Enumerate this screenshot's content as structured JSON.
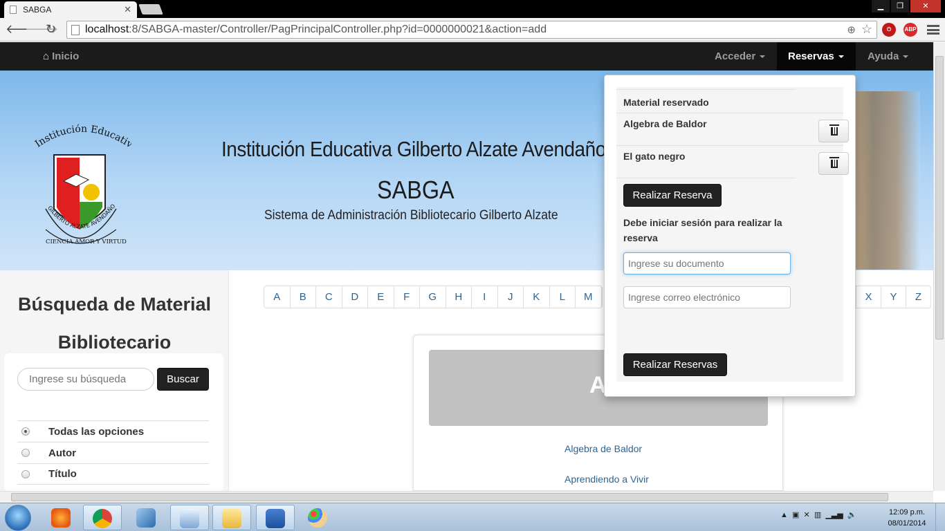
{
  "browser": {
    "tab_title": "SABGA",
    "url_host": "localhost",
    "url_rest": ":8/SABGA-master/Controller/PagPrincipalController.php?id=0000000021&action=add",
    "ext_abp": "ABP"
  },
  "navbar": {
    "brand": "Inicio",
    "items": [
      {
        "label": "Acceder"
      },
      {
        "label": "Reservas"
      },
      {
        "label": "Ayuda"
      }
    ]
  },
  "banner": {
    "institution": "Institución Educativa Gilberto Alzate Avendaño",
    "acronym": "SABGA",
    "subtitle": "Sistema de Administración Bibliotecario Gilberto Alzate",
    "seal_top": "Institución Educativa",
    "seal_bottom1": "GILBERTO ALZATE AVENDAÑO",
    "seal_bottom2": "CIENCIA  AMOR Y VIRTUD"
  },
  "sidebar": {
    "title": "Búsqueda de Material Bibliotecario",
    "search_placeholder": "Ingrese su búsqueda",
    "search_button": "Buscar",
    "options": [
      {
        "label": "Todas las opciones",
        "selected": true
      },
      {
        "label": "Autor",
        "selected": false
      },
      {
        "label": "Título",
        "selected": false
      }
    ]
  },
  "alphabet": {
    "left": [
      "A",
      "B",
      "C",
      "D",
      "E",
      "F",
      "G",
      "H",
      "I",
      "J",
      "K",
      "L",
      "M"
    ],
    "right": [
      "X",
      "Y",
      "Z"
    ]
  },
  "main": {
    "jumbotron_letter": "A",
    "books": [
      "Algebra de Baldor",
      "Aprendiendo a Vivir"
    ]
  },
  "reservas_dropdown": {
    "header": "Material reservado",
    "items": [
      {
        "title": "Algebra de Baldor"
      },
      {
        "title": "El gato negro"
      }
    ],
    "reserve_button": "Realizar Reserva",
    "login_notice": "Debe iniciar sesión para realizar la reserva",
    "document_placeholder": "Ingrese su documento",
    "email_placeholder": "Ingrese correo electrónico",
    "submit_button": "Realizar Reservas"
  },
  "taskbar": {
    "time": "12:09 p.m.",
    "date": "08/01/2014"
  },
  "colors": {
    "navbar_bg": "#1b1b1b",
    "link": "#2a6496",
    "banner_top": "#7db8ea",
    "seal_red": "#e02020",
    "seal_green": "#3a9a2a"
  }
}
